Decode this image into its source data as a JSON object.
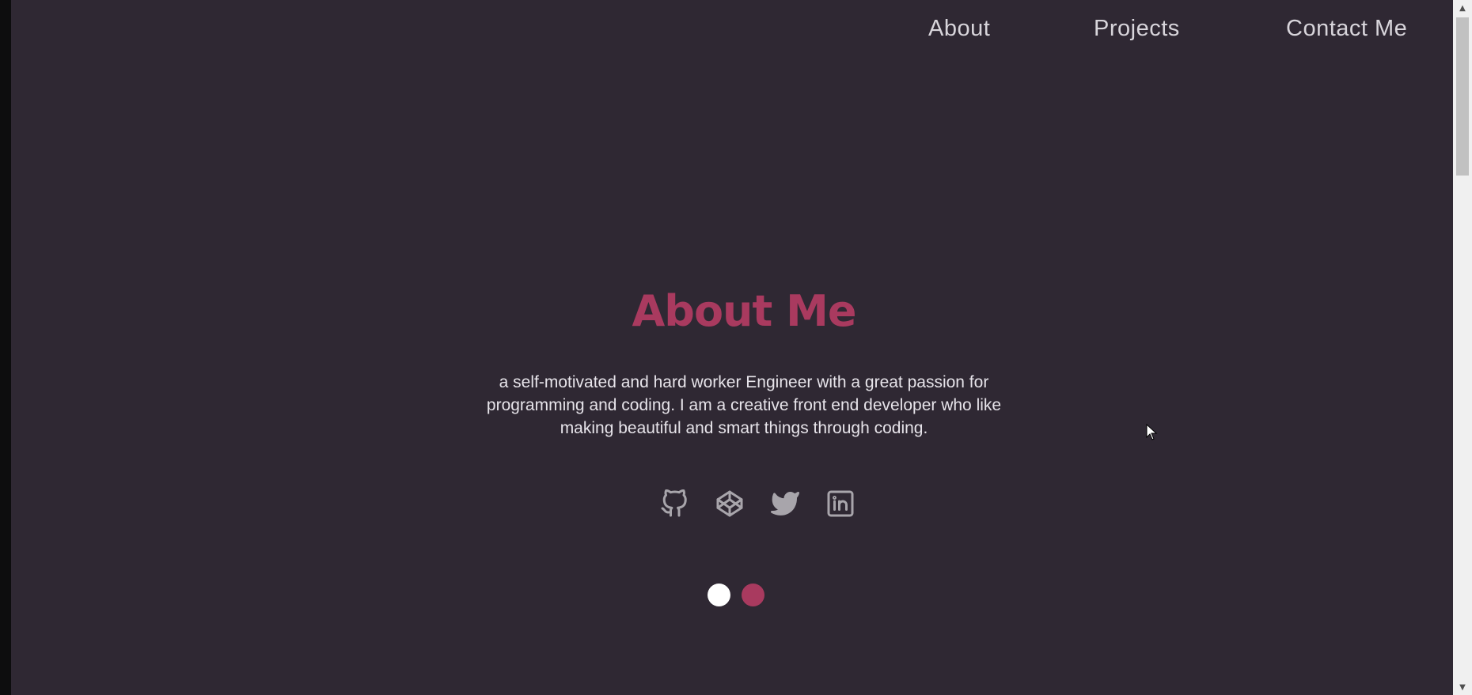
{
  "nav": {
    "items": [
      {
        "label": "About"
      },
      {
        "label": "Projects"
      },
      {
        "label": "Contact Me"
      }
    ]
  },
  "hero": {
    "title": "About Me",
    "bio_lines": [
      "a self-motivated and hard worker Engineer with a great passion for",
      "programming and coding. I am a creative front end developer who like",
      "making beautiful and smart things through coding."
    ]
  },
  "socials": [
    {
      "icon": "github-icon"
    },
    {
      "icon": "codepen-icon"
    },
    {
      "icon": "twitter-icon"
    },
    {
      "icon": "linkedin-icon"
    }
  ],
  "slider_dots": [
    {
      "color": "#ffffff",
      "active": false
    },
    {
      "color": "#a93a5f",
      "active": true
    }
  ],
  "colors": {
    "background": "#2f2833",
    "accent": "#a93a5f",
    "nav_text": "#d8d5db",
    "icon": "#a8a5ab"
  }
}
